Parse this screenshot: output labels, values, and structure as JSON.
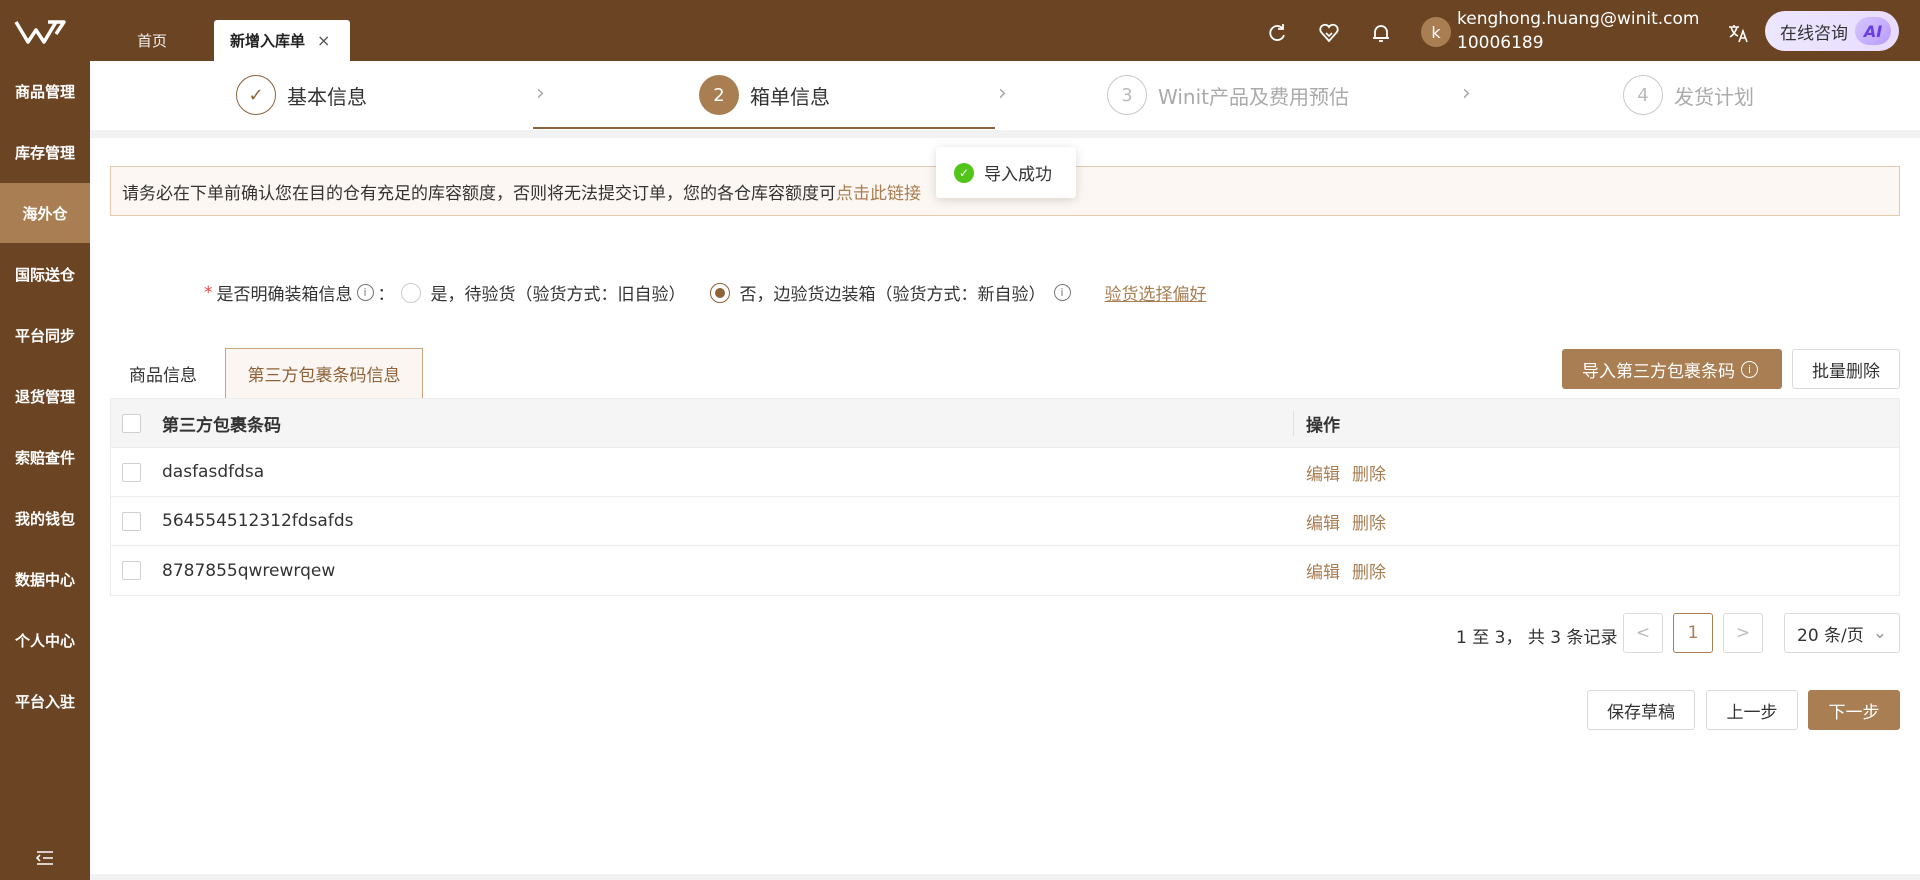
{
  "header": {
    "tabs": [
      {
        "label": "首页"
      },
      {
        "label": "新增入库单",
        "close": "×"
      }
    ],
    "user": {
      "avatar_letter": "k",
      "email": "kenghong.huang@winit.com",
      "id": "10006189"
    },
    "ai_button": {
      "label": "在线咨询",
      "badge": "AI"
    }
  },
  "sidebar": {
    "items": [
      {
        "label": "商品管理"
      },
      {
        "label": "库存管理"
      },
      {
        "label": "海外仓"
      },
      {
        "label": "国际送仓"
      },
      {
        "label": "平台同步"
      },
      {
        "label": "退货管理"
      },
      {
        "label": "索赔查件"
      },
      {
        "label": "我的钱包"
      },
      {
        "label": "数据中心"
      },
      {
        "label": "个人中心"
      },
      {
        "label": "平台入驻"
      }
    ],
    "active_index": 2
  },
  "steps": [
    {
      "number": "✓",
      "label": "基本信息",
      "state": "done"
    },
    {
      "number": "2",
      "label": "箱单信息",
      "state": "active"
    },
    {
      "number": "3",
      "label": "Winit产品及费用预估",
      "state": "pending"
    },
    {
      "number": "4",
      "label": "发货计划",
      "state": "pending"
    }
  ],
  "notice": {
    "text": "请务必在下单前确认您在目的仓有充足的库容额度，否则将无法提交订单，您的各仓库容额度可",
    "link": "点击此链接"
  },
  "toast": {
    "text": "导入成功"
  },
  "form": {
    "label": "是否明确装箱信息",
    "colon": "：",
    "option_yes": "是，待验货（验货方式：旧自验）",
    "option_no": "否，边验货边装箱（验货方式：新自验）",
    "pref_link": "验货选择偏好"
  },
  "subtabs": [
    {
      "label": "商品信息"
    },
    {
      "label": "第三方包裹条码信息"
    }
  ],
  "actions": {
    "import": "导入第三方包裹条码",
    "batch_delete": "批量删除"
  },
  "table": {
    "headers": [
      "第三方包裹条码",
      "操作"
    ],
    "rows": [
      {
        "code": "dasfasdfdsa",
        "edit": "编辑",
        "delete": "删除"
      },
      {
        "code": "564554512312fdsafds",
        "edit": "编辑",
        "delete": "删除"
      },
      {
        "code": "8787855qwrewrqew",
        "edit": "编辑",
        "delete": "删除"
      }
    ]
  },
  "pagination": {
    "info": "1 至 3， 共 3 条记录",
    "prev": "<",
    "current": "1",
    "next": ">",
    "page_size": "20 条/页"
  },
  "footer": {
    "save_draft": "保存草稿",
    "prev_step": "上一步",
    "next_step": "下一步"
  },
  "colors": {
    "brand": "#6b4423",
    "accent": "#a87e52",
    "success": "#52c41a"
  }
}
